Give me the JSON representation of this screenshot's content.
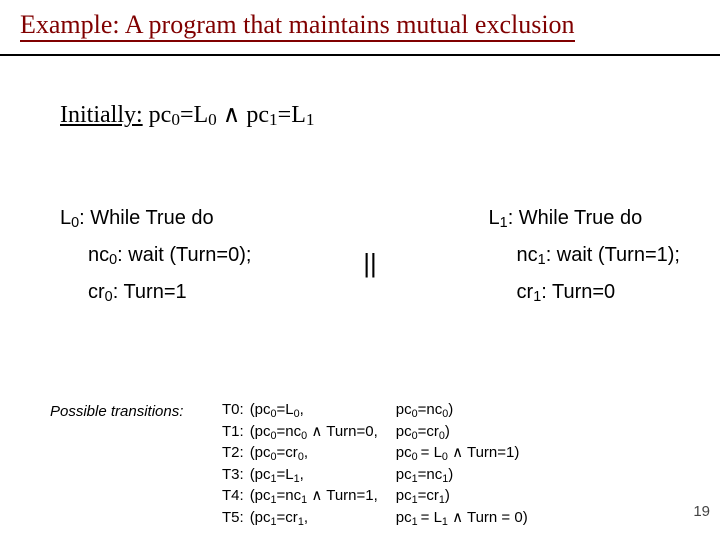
{
  "title": "Example: A program that maintains mutual exclusion",
  "initially": {
    "label": "Initially:",
    "formula_html": "pc<span class=sub>0</span>=L<span class=sub>0</span> ∧ pc<span class=sub>1</span>=L<span class=sub>1</span>"
  },
  "programs": {
    "left": {
      "head_html": "L<span class=sub>0</span>: While True do",
      "line1_html": "nc<span class=sub>0</span>: wait (Turn=0);",
      "line2_html": "cr<span class=sub>0</span>: Turn=1"
    },
    "parallel": "||",
    "right": {
      "head_html": "L<span class=sub>1</span>: While True do",
      "line1_html": "nc<span class=sub>1</span>: wait (Turn=1);",
      "line2_html": "cr<span class=sub>1</span>: Turn=0"
    }
  },
  "transitions": {
    "label": "Possible transitions:",
    "rows": [
      {
        "key": "T0:",
        "mid_html": "(pc<span class=sub>0</span>=L<span class=sub>0</span>,",
        "rhs_html": "pc<span class=sub>0</span>=nc<span class=sub>0</span>)"
      },
      {
        "key": "T1:",
        "mid_html": "(pc<span class=sub>0</span>=nc<span class=sub>0</span> ∧ Turn=0,",
        "rhs_html": "pc<span class=sub>0</span>=cr<span class=sub>0</span>)"
      },
      {
        "key": "T2:",
        "mid_html": "(pc<span class=sub>0</span>=cr<span class=sub>0</span>,",
        "rhs_html": "pc<span class=sub>0 </span>= L<span class=sub>0</span> ∧ Turn=1)"
      },
      {
        "key": "T3:",
        "mid_html": "(pc<span class=sub>1</span>=L<span class=sub>1</span>,",
        "rhs_html": "pc<span class=sub>1</span>=nc<span class=sub>1</span>)"
      },
      {
        "key": "T4:",
        "mid_html": "(pc<span class=sub>1</span>=nc<span class=sub>1</span> ∧ Turn=1,",
        "rhs_html": "pc<span class=sub>1</span>=cr<span class=sub>1</span>)"
      },
      {
        "key": "T5:",
        "mid_html": "(pc<span class=sub>1</span>=cr<span class=sub>1</span>,",
        "rhs_html": "pc<span class=sub>1 </span>= L<span class=sub>1</span> ∧ Turn = 0)"
      }
    ]
  },
  "page_number": "19"
}
